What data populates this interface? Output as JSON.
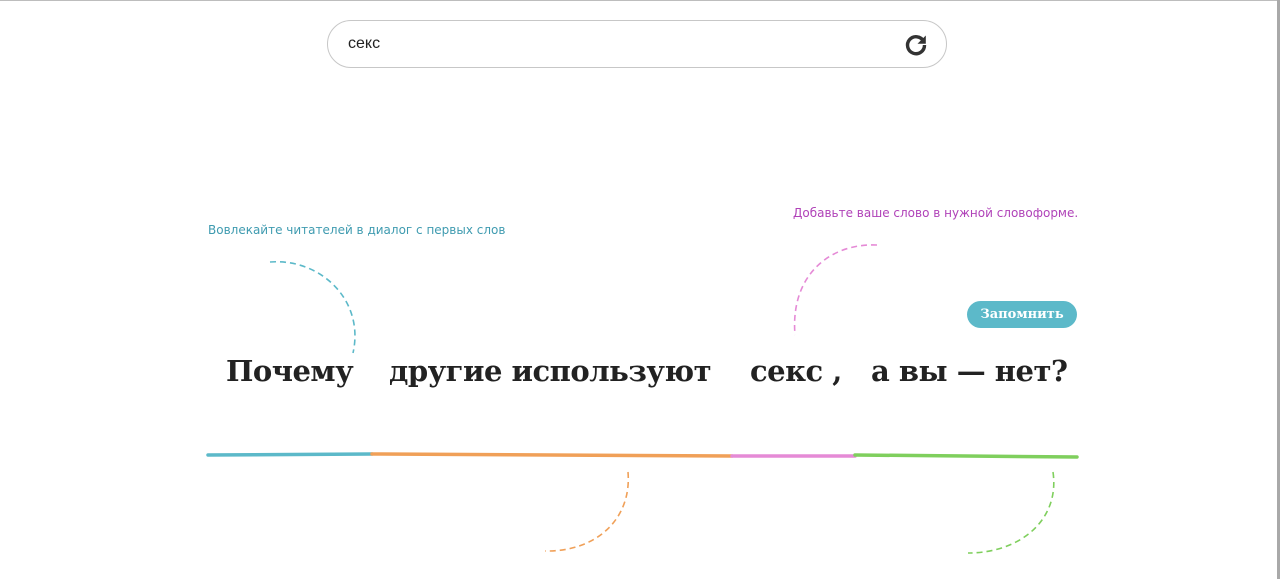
{
  "search": {
    "value": "секс",
    "refresh_icon": "refresh-icon"
  },
  "hints": {
    "left": "Вовлекайте читателей в диалог с первых слов",
    "right": "Добавьте ваше слово в нужной словоформе."
  },
  "remember_button": {
    "label": "Запомнить"
  },
  "headline": {
    "part1": "Почему",
    "part2": "другие используют",
    "part3": "секс ,",
    "part4": "а вы — нет?"
  },
  "colors": {
    "teal": "#5cb9c9",
    "orange": "#f0a058",
    "pink": "#e58ad6",
    "green": "#7fcf5d",
    "text": "#222222"
  }
}
